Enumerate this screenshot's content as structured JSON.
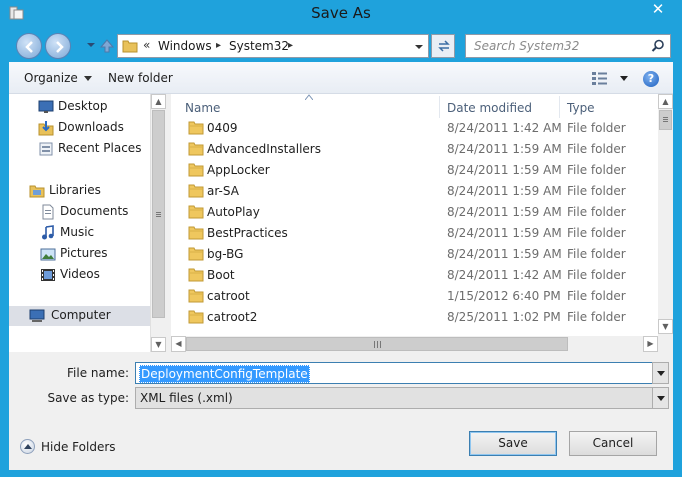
{
  "window": {
    "title": "Save As",
    "close_label": "✕"
  },
  "address": {
    "sep_overflow": "«",
    "crumbs": [
      "Windows",
      "System32"
    ],
    "sep_arrow": "▸"
  },
  "search": {
    "placeholder": "Search System32"
  },
  "toolbar": {
    "organize": "Organize",
    "new_folder": "New folder",
    "help": "?"
  },
  "nav": {
    "favorites": [
      {
        "label": "Desktop",
        "icon": "desktop-icon"
      },
      {
        "label": "Downloads",
        "icon": "downloads-icon"
      },
      {
        "label": "Recent Places",
        "icon": "recent-places-icon"
      }
    ],
    "libraries": {
      "label": "Libraries",
      "items": [
        {
          "label": "Documents",
          "icon": "documents-icon"
        },
        {
          "label": "Music",
          "icon": "music-icon"
        },
        {
          "label": "Pictures",
          "icon": "pictures-icon"
        },
        {
          "label": "Videos",
          "icon": "videos-icon"
        }
      ]
    },
    "computer": {
      "label": "Computer",
      "selected": true
    }
  },
  "files": {
    "columns": {
      "name": "Name",
      "date": "Date modified",
      "type": "Type"
    },
    "rows": [
      {
        "name": "0409",
        "date": "8/24/2011 1:42 AM",
        "type": "File folder"
      },
      {
        "name": "AdvancedInstallers",
        "date": "8/24/2011 1:59 AM",
        "type": "File folder"
      },
      {
        "name": "AppLocker",
        "date": "8/24/2011 1:59 AM",
        "type": "File folder"
      },
      {
        "name": "ar-SA",
        "date": "8/24/2011 1:59 AM",
        "type": "File folder"
      },
      {
        "name": "AutoPlay",
        "date": "8/24/2011 1:59 AM",
        "type": "File folder"
      },
      {
        "name": "BestPractices",
        "date": "8/24/2011 1:59 AM",
        "type": "File folder"
      },
      {
        "name": "bg-BG",
        "date": "8/24/2011 1:59 AM",
        "type": "File folder"
      },
      {
        "name": "Boot",
        "date": "8/24/2011 1:42 AM",
        "type": "File folder"
      },
      {
        "name": "catroot",
        "date": "1/15/2012 6:40 PM",
        "type": "File folder"
      },
      {
        "name": "catroot2",
        "date": "8/25/2011 1:02 PM",
        "type": "File folder"
      }
    ]
  },
  "form": {
    "file_name_label": "File name:",
    "file_name_value": "DeploymentConfigTemplate",
    "save_type_label": "Save as type:",
    "save_type_value": "XML files (.xml)"
  },
  "footer": {
    "hide_folders": "Hide Folders",
    "save": "Save",
    "cancel": "Cancel"
  },
  "colors": {
    "frame": "#1fa2dc",
    "selection": "#3399ff"
  }
}
